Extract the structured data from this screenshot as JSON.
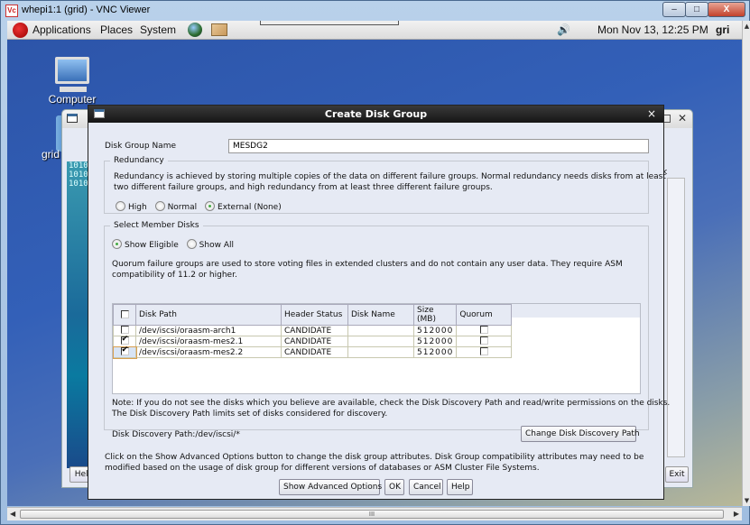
{
  "vnc": {
    "title": "whepi1:1 (grid) - VNC Viewer",
    "logo": "Vc",
    "minimize": "–",
    "maximize": "□",
    "close": "X"
  },
  "panel": {
    "menus": [
      "Applications",
      "Places",
      "System"
    ],
    "clock": "Mon Nov 13, 12:25 PM",
    "user": "gri"
  },
  "desktop": {
    "icons": [
      {
        "label": "Computer",
        "icon": "computer-icon"
      },
      {
        "label": "grid",
        "icon": "folder-icon"
      }
    ]
  },
  "background_window": {
    "help_label": "Help",
    "exit_label": "Exit",
    "banner_text": [
      "1010",
      "1010",
      "1010"
    ],
    "partial_text": "k"
  },
  "dialog": {
    "title": "Create Disk Group",
    "disk_group_name_label": "Disk Group Name",
    "disk_group_name_value": "MESDG2",
    "redundancy": {
      "legend": "Redundancy",
      "description_line1": "Redundancy is achieved by storing multiple copies of the data on different failure groups. Normal redundancy needs disks from at least",
      "description_line2": "two different failure groups, and high redundancy from at least three different failure groups.",
      "options": [
        {
          "label": "High",
          "selected": false
        },
        {
          "label": "Normal",
          "selected": false
        },
        {
          "label": "External (None)",
          "selected": true
        }
      ]
    },
    "member_disks": {
      "legend": "Select Member Disks",
      "filter_options": [
        {
          "label": "Show Eligible",
          "selected": true
        },
        {
          "label": "Show All",
          "selected": false
        }
      ],
      "quorum_note_line1": "Quorum failure groups are used to store voting files in extended clusters and do not contain any user data. They require ASM",
      "quorum_note_line2": "compatibility of 11.2 or higher.",
      "table": {
        "columns": [
          "",
          "Disk Path",
          "Header Status",
          "Disk Name",
          "Size (MB)",
          "Quorum"
        ],
        "select_all_checked": false,
        "rows": [
          {
            "selected": false,
            "path": "/dev/iscsi/oraasm-arch1",
            "status": "CANDIDATE",
            "name": "",
            "size": "512000",
            "quorum": false
          },
          {
            "selected": true,
            "path": "/dev/iscsi/oraasm-mes2.1",
            "status": "CANDIDATE",
            "name": "",
            "size": "512000",
            "quorum": false
          },
          {
            "selected": true,
            "path": "/dev/iscsi/oraasm-mes2.2",
            "status": "CANDIDATE",
            "name": "",
            "size": "512000",
            "quorum": false
          }
        ]
      },
      "note_line1": "Note: If you do not see the disks which you believe are available, check the Disk Discovery Path and read/write permissions on the disks.",
      "note_line2": "The Disk Discovery Path limits set of disks considered for discovery.",
      "discovery_path_label": "Disk Discovery Path:/dev/iscsi/*",
      "change_path_button": "Change Disk Discovery Path"
    },
    "advanced_note_line1": "Click on the Show Advanced Options button to change the disk group attributes. Disk Group compatibility attributes may need to be",
    "advanced_note_line2": "modified based on the usage of disk group for different versions of databases or ASM Cluster File Systems.",
    "buttons": {
      "advanced": "Show Advanced Options",
      "ok": "OK",
      "cancel": "Cancel",
      "help": "Help"
    },
    "close": "×"
  },
  "scrollbar": {
    "grip": "III"
  }
}
